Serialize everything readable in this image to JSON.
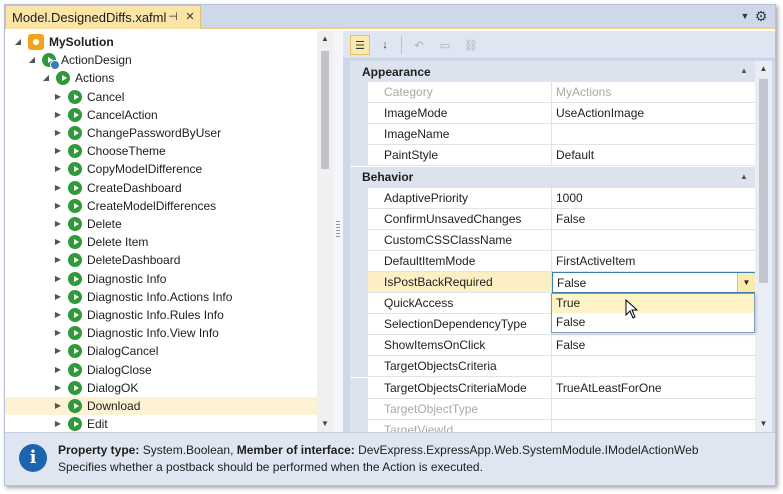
{
  "tab": {
    "title": "Model.DesignedDiffs.xafml",
    "pin": "⊣",
    "close": "✕"
  },
  "tree": {
    "items": [
      {
        "label": "MySolution",
        "depth": 0,
        "expanded": true,
        "bold": true,
        "icon": "solution-icon"
      },
      {
        "label": "ActionDesign",
        "depth": 1,
        "expanded": true,
        "bold": false,
        "icon": "action-design-icon"
      },
      {
        "label": "Actions",
        "depth": 2,
        "expanded": true,
        "bold": false,
        "icon": "action-icon"
      },
      {
        "label": "Cancel",
        "depth": 3,
        "expanded": false,
        "icon": "action-icon"
      },
      {
        "label": "CancelAction",
        "depth": 3,
        "expanded": false,
        "icon": "action-icon"
      },
      {
        "label": "ChangePasswordByUser",
        "depth": 3,
        "expanded": false,
        "icon": "action-icon"
      },
      {
        "label": "ChooseTheme",
        "depth": 3,
        "expanded": false,
        "icon": "action-icon"
      },
      {
        "label": "CopyModelDifference",
        "depth": 3,
        "expanded": false,
        "icon": "action-icon"
      },
      {
        "label": "CreateDashboard",
        "depth": 3,
        "expanded": false,
        "icon": "action-icon"
      },
      {
        "label": "CreateModelDifferences",
        "depth": 3,
        "expanded": false,
        "icon": "action-icon"
      },
      {
        "label": "Delete",
        "depth": 3,
        "expanded": false,
        "icon": "action-icon"
      },
      {
        "label": "Delete Item",
        "depth": 3,
        "expanded": false,
        "icon": "action-icon"
      },
      {
        "label": "DeleteDashboard",
        "depth": 3,
        "expanded": false,
        "icon": "action-icon"
      },
      {
        "label": "Diagnostic Info",
        "depth": 3,
        "expanded": false,
        "icon": "action-icon"
      },
      {
        "label": "Diagnostic Info.Actions Info",
        "depth": 3,
        "expanded": false,
        "icon": "action-icon"
      },
      {
        "label": "Diagnostic Info.Rules Info",
        "depth": 3,
        "expanded": false,
        "icon": "action-icon"
      },
      {
        "label": "Diagnostic Info.View Info",
        "depth": 3,
        "expanded": false,
        "icon": "action-icon"
      },
      {
        "label": "DialogCancel",
        "depth": 3,
        "expanded": false,
        "icon": "action-icon"
      },
      {
        "label": "DialogClose",
        "depth": 3,
        "expanded": false,
        "icon": "action-icon"
      },
      {
        "label": "DialogOK",
        "depth": 3,
        "expanded": false,
        "icon": "action-icon"
      },
      {
        "label": "Download",
        "depth": 3,
        "expanded": false,
        "selected": true,
        "icon": "action-icon"
      },
      {
        "label": "Edit",
        "depth": 3,
        "expanded": false,
        "icon": "action-icon"
      }
    ]
  },
  "toolbar": {
    "buttons": [
      {
        "name": "categorized-view-button",
        "icon": "categorized-icon",
        "glyph": "☰",
        "active": true,
        "disabled": false
      },
      {
        "name": "alphabetical-view-button",
        "icon": "sort-az-icon",
        "glyph": "↓",
        "active": false,
        "disabled": false
      },
      {
        "name": "reset-value-button",
        "icon": "undo-icon",
        "glyph": "↶",
        "active": false,
        "disabled": true
      },
      {
        "name": "navigate-button",
        "icon": "window-icon",
        "glyph": "▭",
        "active": false,
        "disabled": true
      },
      {
        "name": "link-button",
        "icon": "link-icon",
        "glyph": "⛓",
        "active": false,
        "disabled": true
      }
    ]
  },
  "property_grid": {
    "categories": [
      {
        "name": "Appearance",
        "properties": [
          {
            "name": "Category",
            "value": "MyActions",
            "disabled": true
          },
          {
            "name": "ImageMode",
            "value": "UseActionImage"
          },
          {
            "name": "ImageName",
            "value": ""
          },
          {
            "name": "PaintStyle",
            "value": "Default"
          }
        ]
      },
      {
        "name": "Behavior",
        "properties": [
          {
            "name": "AdaptivePriority",
            "value": "1000"
          },
          {
            "name": "ConfirmUnsavedChanges",
            "value": "False"
          },
          {
            "name": "CustomCSSClassName",
            "value": ""
          },
          {
            "name": "DefaultItemMode",
            "value": "FirstActiveItem"
          },
          {
            "name": "IsPostBackRequired",
            "value": "False",
            "focused": true
          },
          {
            "name": "QuickAccess",
            "value": ""
          },
          {
            "name": "SelectionDependencyType",
            "value": ""
          },
          {
            "name": "ShowItemsOnClick",
            "value": "False"
          },
          {
            "name": "TargetObjectsCriteria",
            "value": ""
          },
          {
            "name": "TargetObjectsCriteriaMode",
            "value": "TrueAtLeastForOne"
          },
          {
            "name": "TargetObjectType",
            "value": "",
            "disabled": true
          },
          {
            "name": "TargetViewId",
            "value": "",
            "disabled": true
          }
        ]
      }
    ],
    "dropdown": {
      "options": [
        "True",
        "False"
      ],
      "hovered": "True"
    }
  },
  "description": {
    "property_type_label": "Property type:",
    "property_type_value": "System.Boolean,",
    "member_label": "Member of interface:",
    "member_value": "DevExpress.ExpressApp.Web.SystemModule.IModelActionWeb",
    "text": "Specifies whether a postback should be performed when the Action is executed."
  },
  "colors": {
    "tab_active": "#fbe4a6",
    "title_strip": "#cfd8e8",
    "category_bg": "#dde3ee",
    "action_icon": "#2f9a3a",
    "info_icon": "#1c64b0"
  }
}
